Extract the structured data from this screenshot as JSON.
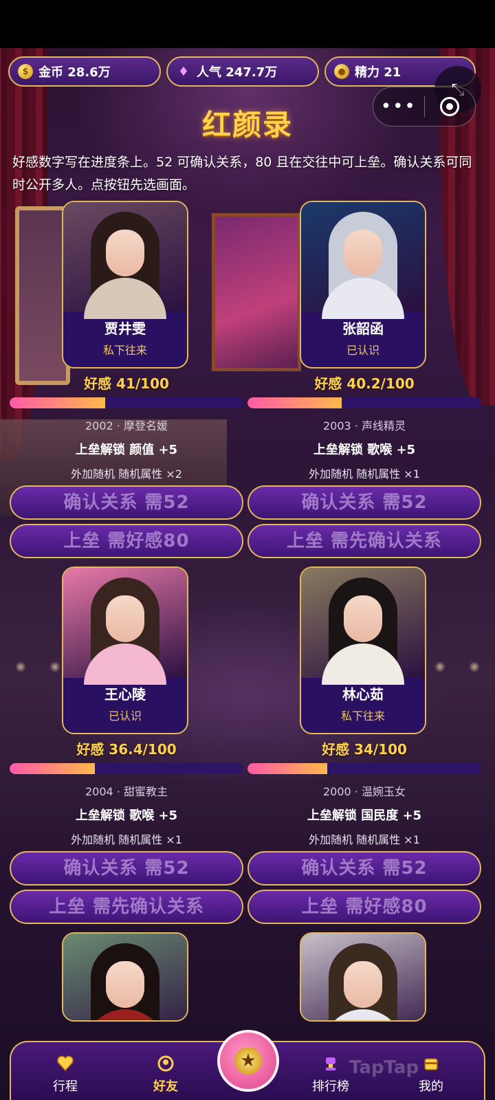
{
  "stats": {
    "coins": "金币 28.6万",
    "popularity": "人气 247.7万",
    "energy": "精力 21"
  },
  "header": {
    "title": "红颜录",
    "intro": "好感数字写在进度条上。52 可确认关系，80 且在交往中可上垒。确认关系可同时公开多人。点按钮先选画面。"
  },
  "miniprogram": {
    "more": "•••"
  },
  "cards": [
    {
      "name": "贾井雯",
      "status": "私下往来",
      "favor_text": "好感 41/100",
      "favor": 41,
      "meta": "2002 · 摩登名媛",
      "unlock": "上垒解锁  颜值 +5",
      "bonus": "外加随机  随机属性 ×2",
      "btn_confirm": "确认关系 需52",
      "btn_advance": "上垒 需好感80",
      "hair": "#2a1a18",
      "outfit": "#d8c8b8",
      "bg": "#6a4a60"
    },
    {
      "name": "张韶函",
      "status": "已认识",
      "favor_text": "好感 40.2/100",
      "favor": 40.2,
      "meta": "2003 · 声线精灵",
      "unlock": "上垒解锁  歌喉 +5",
      "bonus": "外加随机  随机属性 ×1",
      "btn_confirm": "确认关系 需52",
      "btn_advance": "上垒 需先确认关系",
      "hair": "#c8ccd8",
      "outfit": "#e8e8f0",
      "bg": "#1a3a6a"
    },
    {
      "name": "王心陵",
      "status": "已认识",
      "favor_text": "好感 36.4/100",
      "favor": 36.4,
      "meta": "2004 · 甜蜜教主",
      "unlock": "上垒解锁  歌喉 +5",
      "bonus": "外加随机  随机属性 ×1",
      "btn_confirm": "确认关系 需52",
      "btn_advance": "上垒 需先确认关系",
      "hair": "#3a2420",
      "outfit": "#f4b8d0",
      "bg": "#e87aa8"
    },
    {
      "name": "林心茹",
      "status": "私下往来",
      "favor_text": "好感 34/100",
      "favor": 34,
      "meta": "2000 · 温婉玉女",
      "unlock": "上垒解锁  国民度 +5",
      "bonus": "外加随机  随机属性 ×1",
      "btn_confirm": "确认关系 需52",
      "btn_advance": "上垒 需好感80",
      "hair": "#1a1414",
      "outfit": "#f0ece4",
      "bg": "#8a7a60"
    }
  ],
  "peek_cards": [
    {
      "hair": "#1a1010",
      "outfit": "#9a2020",
      "bg": "#6a8a70"
    },
    {
      "hair": "#3a2a20",
      "outfit": "#e8e8f0",
      "bg": "#c8c0c8"
    }
  ],
  "nav": {
    "itinerary": "行程",
    "friends": "好友",
    "ranking": "排行榜",
    "mine": "我的"
  },
  "watermark": "TapTap"
}
